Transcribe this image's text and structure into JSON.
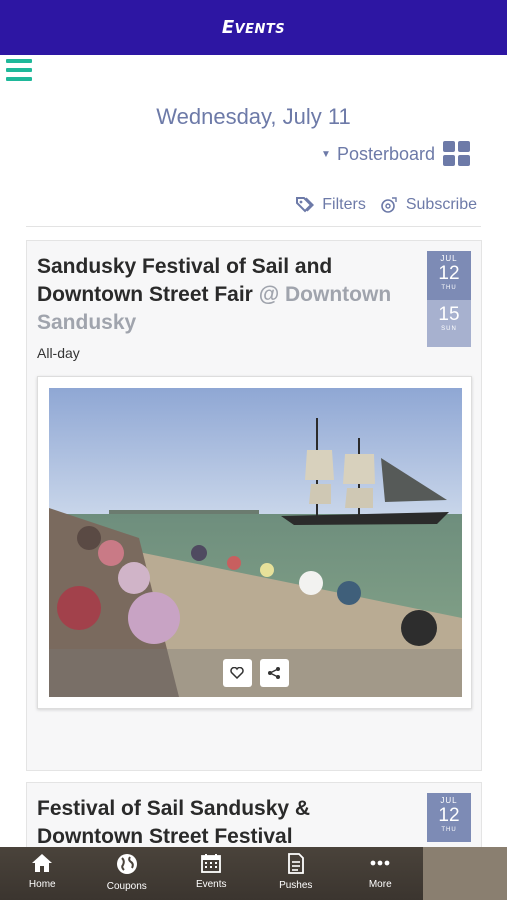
{
  "header": {
    "title": "Events"
  },
  "date_heading": "Wednesday, July 11",
  "view_toggle": {
    "label": "Posterboard"
  },
  "filters": {
    "filters_label": "Filters",
    "subscribe_label": "Subscribe"
  },
  "events": [
    {
      "title": "Sandusky Festival of Sail and Downtown Street Fair",
      "location": "@ Downtown Sandusky",
      "time": "All-day",
      "badge": {
        "start_month": "JUL",
        "start_day": "12",
        "start_dow": "THU",
        "end_day": "15",
        "end_dow": "SUN"
      }
    },
    {
      "title": "Festival of Sail Sandusky & Downtown Street Festival",
      "badge": {
        "start_month": "JUL",
        "start_day": "12",
        "start_dow": "THU"
      }
    }
  ],
  "nav": [
    {
      "label": "Home",
      "icon": "home-icon"
    },
    {
      "label": "Coupons",
      "icon": "globe-icon"
    },
    {
      "label": "Events",
      "icon": "calendar-icon"
    },
    {
      "label": "Pushes",
      "icon": "document-icon"
    },
    {
      "label": "More",
      "icon": "more-icon"
    }
  ],
  "colors": {
    "header": "#2d16a3",
    "accent": "#1fb89a",
    "muted_text": "#6d7aa8",
    "badge_top": "#7d8bb5",
    "badge_bottom": "#a7b1cf"
  }
}
